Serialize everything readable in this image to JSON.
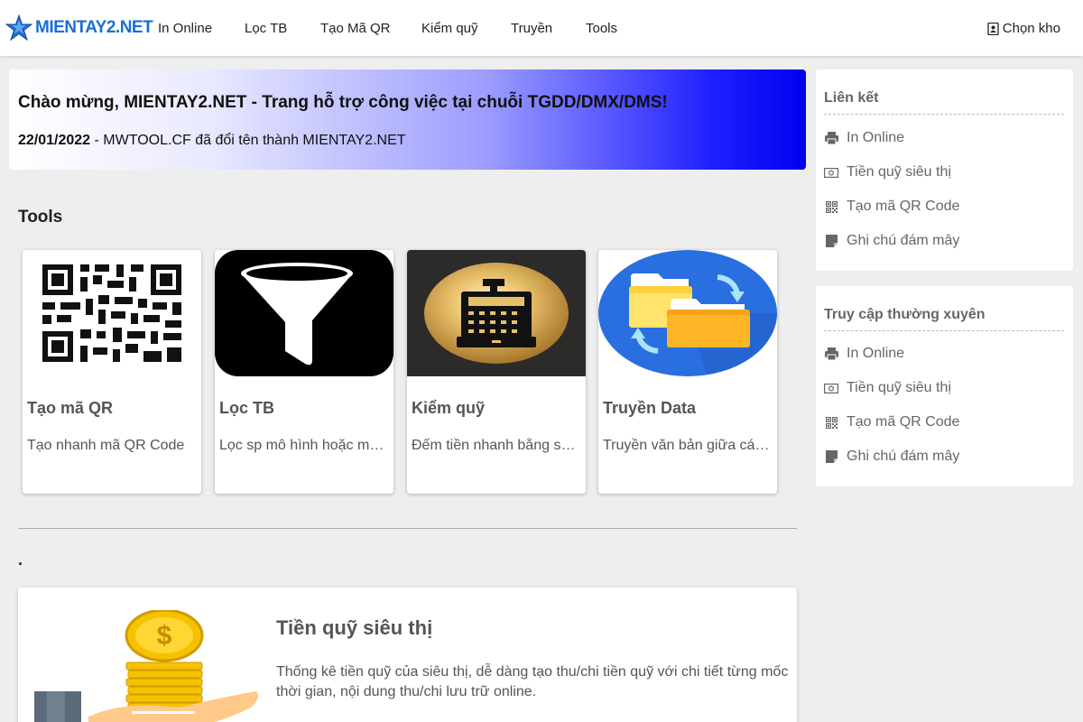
{
  "header": {
    "logo_text": "MIENTAY2.NET",
    "nav": [
      "In Online",
      "Lọc TB",
      "Tạo Mã QR",
      "Kiểm quỹ",
      "Truyền",
      "Tools"
    ],
    "store_label": "Chọn kho",
    "store_icon": "address-book-icon"
  },
  "banner": {
    "title": "Chào mừng, MIENTAY2.NET - Trang hỗ trợ công việc tại chuỗi TGDD/DMX/DMS!",
    "note_date": "22/01/2022",
    "note_sep": " - ",
    "note_text": "MWTOOL.CF đã đổi tên thành MIENTAY2.NET"
  },
  "tools": {
    "heading": "Tools",
    "cards": [
      {
        "title": "Tạo mã QR",
        "desc": "Tạo nhanh mã QR Code",
        "icon": "qr-code-icon"
      },
      {
        "title": "Lọc TB",
        "desc": "Lọc sp mô hình hoặc máy trưng bày",
        "icon": "filter-icon"
      },
      {
        "title": "Kiểm quỹ",
        "desc": "Đếm tiền nhanh bằng số lượng tờ",
        "icon": "cash-register-icon"
      },
      {
        "title": "Truyền Data",
        "desc": "Truyền văn bản giữa các thiết bị",
        "icon": "folder-transfer-icon"
      }
    ]
  },
  "section_dot": ".",
  "feature": {
    "title": "Tiền quỹ siêu thị",
    "desc": "Thống kê tiền quỹ của siêu thị, dễ dàng tạo thu/chi tiền quỹ với chi tiết từng mốc thời gian, nội dung thu/chi lưu trữ online."
  },
  "sidebar": {
    "links": {
      "title": "Liên kết",
      "items": [
        {
          "label": "In Online",
          "icon": "printer-icon"
        },
        {
          "label": "Tiền quỹ siêu thị",
          "icon": "money-bill-icon"
        },
        {
          "label": "Tạo mã QR Code",
          "icon": "qrcode-icon"
        },
        {
          "label": "Ghi chú đám mây",
          "icon": "sticky-note-icon"
        }
      ]
    },
    "frequent": {
      "title": "Truy cập thường xuyên",
      "items": [
        {
          "label": "In Online",
          "icon": "printer-icon"
        },
        {
          "label": "Tiền quỹ siêu thị",
          "icon": "money-bill-icon"
        },
        {
          "label": "Tạo mã QR Code",
          "icon": "qrcode-icon"
        },
        {
          "label": "Ghi chú đám mây",
          "icon": "sticky-note-icon"
        }
      ]
    }
  },
  "colors": {
    "brand_blue": "#1a6fd6",
    "banner_end": "#0000f0",
    "page_bg": "#eeeeee"
  }
}
